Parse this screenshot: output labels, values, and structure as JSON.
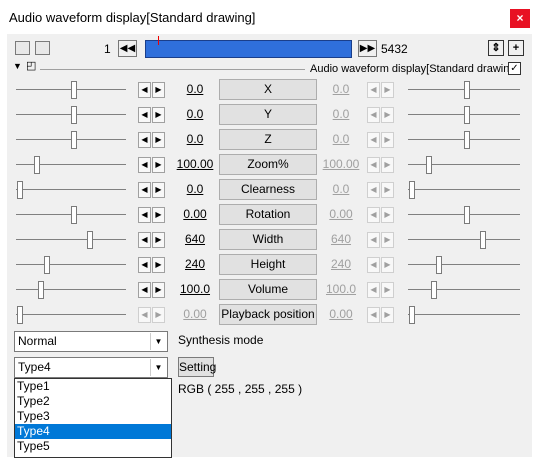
{
  "window": {
    "title": "Audio waveform display[Standard drawing]",
    "close_glyph": "×"
  },
  "toolbar": {
    "frame_start": "1",
    "frame_end": "5432",
    "prev_frame_glyph": "◀◀",
    "next_frame_glyph": "▶▶",
    "updown_glyph": "⇕",
    "plus_glyph": "+"
  },
  "object": {
    "name": "Audio waveform display[Standard drawing]",
    "visible_checked": true,
    "check_glyph": "✓"
  },
  "params": [
    {
      "label": "X",
      "left_value": "0.0",
      "right_value": "0.0",
      "left_pos": 0.52,
      "right_pos": 0.52,
      "enabled": true
    },
    {
      "label": "Y",
      "left_value": "0.0",
      "right_value": "0.0",
      "left_pos": 0.52,
      "right_pos": 0.52,
      "enabled": true
    },
    {
      "label": "Z",
      "left_value": "0.0",
      "right_value": "0.0",
      "left_pos": 0.52,
      "right_pos": 0.52,
      "enabled": true
    },
    {
      "label": "Zoom%",
      "left_value": "100.00",
      "right_value": "100.00",
      "left_pos": 0.18,
      "right_pos": 0.18,
      "enabled": true
    },
    {
      "label": "Clearness",
      "left_value": "0.0",
      "right_value": "0.0",
      "left_pos": 0.03,
      "right_pos": 0.03,
      "enabled": true
    },
    {
      "label": "Rotation",
      "left_value": "0.00",
      "right_value": "0.00",
      "left_pos": 0.52,
      "right_pos": 0.52,
      "enabled": true
    },
    {
      "label": "Width",
      "left_value": "640",
      "right_value": "640",
      "left_pos": 0.66,
      "right_pos": 0.66,
      "enabled": true
    },
    {
      "label": "Height",
      "left_value": "240",
      "right_value": "240",
      "left_pos": 0.27,
      "right_pos": 0.27,
      "enabled": true
    },
    {
      "label": "Volume",
      "left_value": "100.0",
      "right_value": "100.0",
      "left_pos": 0.22,
      "right_pos": 0.22,
      "enabled": true
    },
    {
      "label": "Playback position",
      "left_value": "0.00",
      "right_value": "0.00",
      "left_pos": 0.03,
      "right_pos": 0.03,
      "enabled": false
    }
  ],
  "blend_mode": {
    "value": "Normal",
    "label": "Synthesis mode"
  },
  "type_select": {
    "value": "Type4",
    "options": [
      "Type1",
      "Type2",
      "Type3",
      "Type4",
      "Type5"
    ],
    "selected": "Type4"
  },
  "setting_button": "Setting",
  "color_text": "RGB ( 255 , 255 , 255 )",
  "dropdown_glyph": "▼",
  "arrow_left_glyph": "◀",
  "arrow_right_glyph": "▶"
}
